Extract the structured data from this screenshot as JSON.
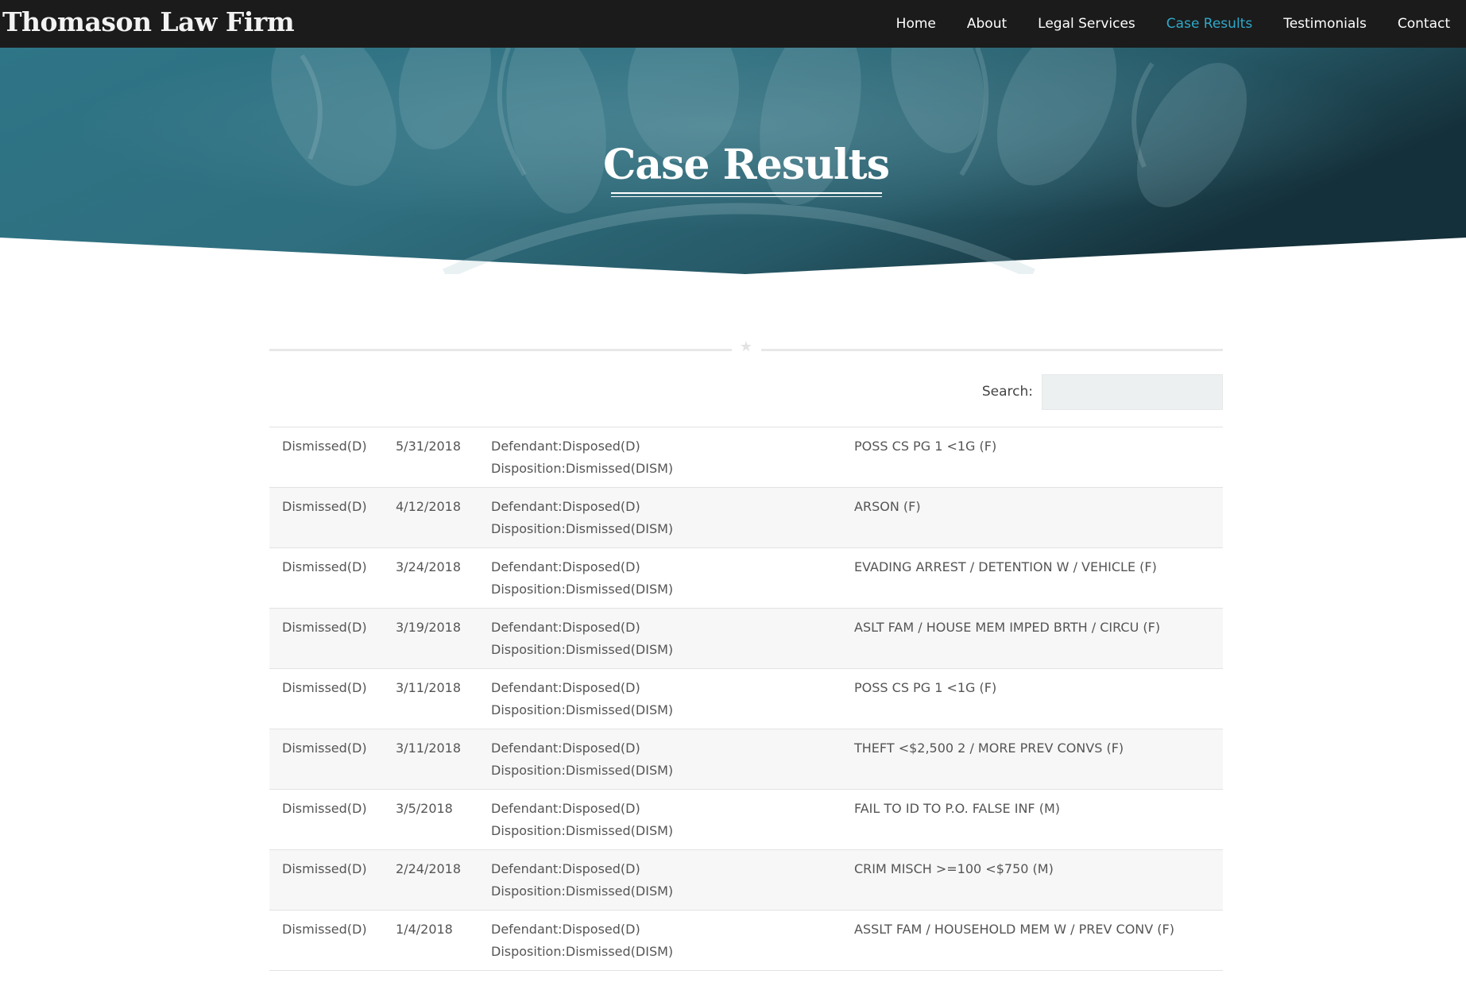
{
  "site": {
    "brand": "Thomason Law Firm"
  },
  "nav": {
    "items": [
      {
        "label": "Home",
        "active": false
      },
      {
        "label": "About",
        "active": false
      },
      {
        "label": "Legal Services",
        "active": false
      },
      {
        "label": "Case Results",
        "active": true
      },
      {
        "label": "Testimonials",
        "active": false
      },
      {
        "label": "Contact",
        "active": false
      }
    ]
  },
  "hero": {
    "title": "Case Results"
  },
  "search": {
    "label": "Search:",
    "value": "",
    "placeholder": ""
  },
  "colors": {
    "nav_bg": "#1b1b1b",
    "nav_active": "#2fa9c9",
    "hero_teal": "#2d6f80"
  },
  "icons": {
    "divider": "star-icon"
  },
  "results": [
    {
      "status": "Dismissed(D)",
      "date": "5/31/2018",
      "defendant": "Defendant:Disposed(D)",
      "disposition": "Disposition:Dismissed(DISM)",
      "charge": "POSS CS PG 1 <1G (F)"
    },
    {
      "status": "Dismissed(D)",
      "date": "4/12/2018",
      "defendant": "Defendant:Disposed(D)",
      "disposition": "Disposition:Dismissed(DISM)",
      "charge": "ARSON (F)"
    },
    {
      "status": "Dismissed(D)",
      "date": "3/24/2018",
      "defendant": "Defendant:Disposed(D)",
      "disposition": "Disposition:Dismissed(DISM)",
      "charge": "EVADING ARREST / DETENTION W / VEHICLE (F)"
    },
    {
      "status": "Dismissed(D)",
      "date": "3/19/2018",
      "defendant": "Defendant:Disposed(D)",
      "disposition": "Disposition:Dismissed(DISM)",
      "charge": "ASLT FAM / HOUSE MEM IMPED BRTH / CIRCU (F)"
    },
    {
      "status": "Dismissed(D)",
      "date": "3/11/2018",
      "defendant": "Defendant:Disposed(D)",
      "disposition": "Disposition:Dismissed(DISM)",
      "charge": "POSS CS PG 1 <1G (F)"
    },
    {
      "status": "Dismissed(D)",
      "date": "3/11/2018",
      "defendant": "Defendant:Disposed(D)",
      "disposition": "Disposition:Dismissed(DISM)",
      "charge": "THEFT <$2,500 2 / MORE PREV CONVS (F)"
    },
    {
      "status": "Dismissed(D)",
      "date": "3/5/2018",
      "defendant": "Defendant:Disposed(D)",
      "disposition": "Disposition:Dismissed(DISM)",
      "charge": "FAIL TO ID TO P.O. FALSE INF (M)"
    },
    {
      "status": "Dismissed(D)",
      "date": "2/24/2018",
      "defendant": "Defendant:Disposed(D)",
      "disposition": "Disposition:Dismissed(DISM)",
      "charge": "CRIM MISCH >=100 <$750 (M)"
    },
    {
      "status": "Dismissed(D)",
      "date": "1/4/2018",
      "defendant": "Defendant:Disposed(D)",
      "disposition": "Disposition:Dismissed(DISM)",
      "charge": "ASSLT FAM / HOUSEHOLD MEM W / PREV CONV (F)"
    }
  ]
}
